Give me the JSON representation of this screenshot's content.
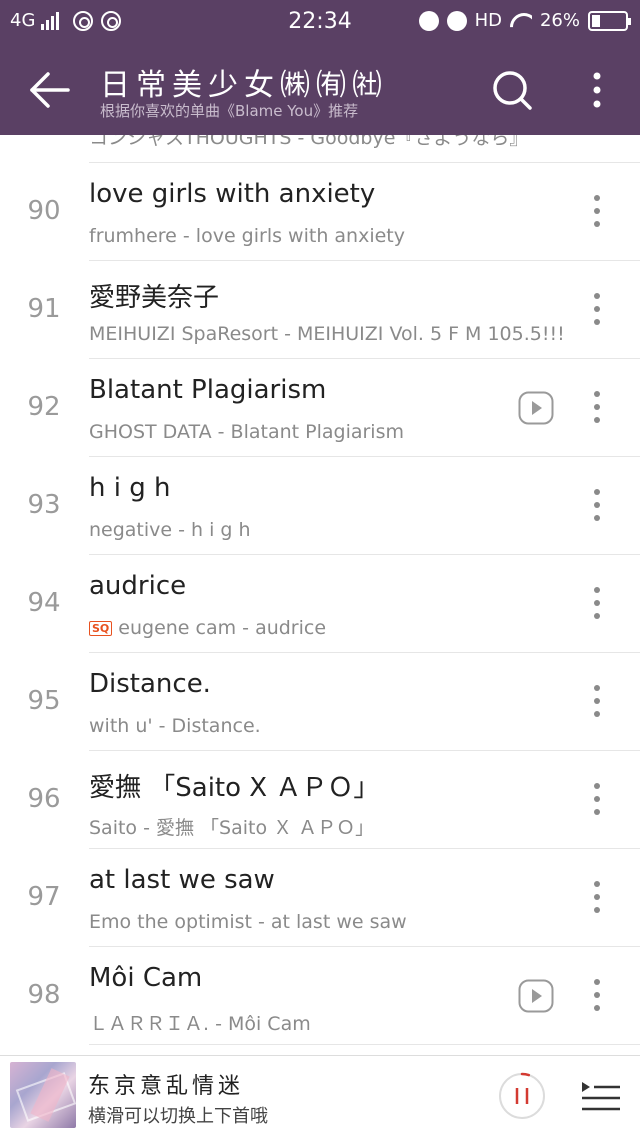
{
  "status_bar": {
    "network": "4G",
    "time": "22:34",
    "hd": "HD",
    "battery_percent": "26%",
    "battery_level": 0.26
  },
  "header": {
    "title": "日常美少女㈱㈲㈳",
    "subtitle": "根据你喜欢的单曲《Blame You》推荐",
    "background_color": "#5a4064"
  },
  "partial_row": {
    "meta": "コンシャスTHOUGHTS - Goodbye『さようなら』"
  },
  "songs": [
    {
      "num": "90",
      "title": "love girls with anxiety",
      "meta": "frumhere - love girls with anxiety",
      "mv": false,
      "sq": ""
    },
    {
      "num": "91",
      "title": "愛野美奈子",
      "meta": "MEIHUIZI SpaResort - MEIHUIZI Vol. 5 F M 105.5!!!",
      "mv": false,
      "sq": ""
    },
    {
      "num": "92",
      "title": "Blatant Plagiarism",
      "meta": "GHOST DATA - Blatant Plagiarism",
      "mv": true,
      "sq": ""
    },
    {
      "num": "93",
      "title": "h i g h",
      "meta": "negative - h i g h",
      "mv": false,
      "sq": ""
    },
    {
      "num": "94",
      "title": "audrice",
      "meta": "eugene cam - audrice",
      "mv": false,
      "sq": "SQ"
    },
    {
      "num": "95",
      "title": "Distance.",
      "meta": "with u' - Distance.",
      "mv": false,
      "sq": ""
    },
    {
      "num": "96",
      "title": "愛撫 「Saito X ＡＰＯ」",
      "meta": "Saito - 愛撫 「Saito Ｘ ＡＰＯ」",
      "mv": false,
      "sq": ""
    },
    {
      "num": "97",
      "title": "at last we saw",
      "meta": "Emo the optimist - at last we saw",
      "mv": false,
      "sq": ""
    },
    {
      "num": "98",
      "title": "Môi Cam",
      "meta": "ＬＡＲＲＩＡ. - Môi Cam",
      "mv": true,
      "sq": ""
    }
  ],
  "player": {
    "title": "东京意乱情迷",
    "subtitle": "横滑可以切换上下首哦",
    "progress": 0.05,
    "progress_color": "#d33a31"
  }
}
